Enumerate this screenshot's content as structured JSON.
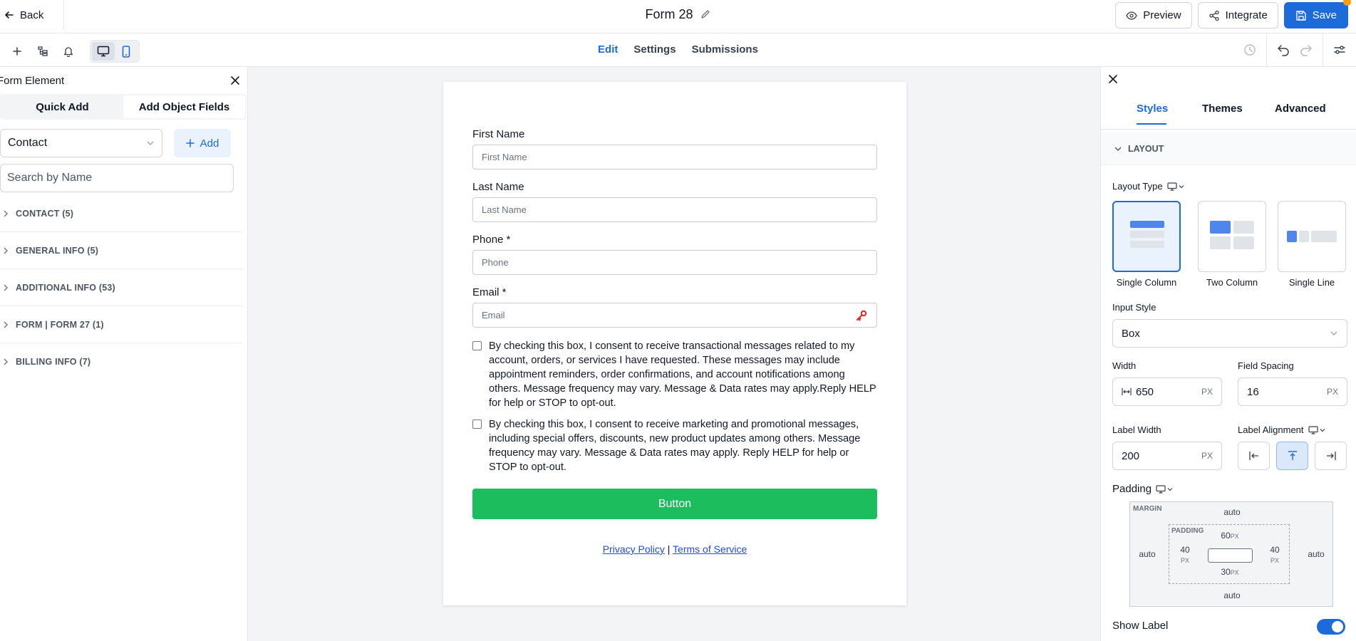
{
  "topbar": {
    "back_label": "Back",
    "form_title": "Form 28",
    "preview_label": "Preview",
    "integrate_label": "Integrate",
    "save_label": "Save"
  },
  "subbar": {
    "tabs": [
      {
        "label": "Edit",
        "active": true
      },
      {
        "label": "Settings",
        "active": false
      },
      {
        "label": "Submissions",
        "active": false
      }
    ],
    "device_selected": "desktop"
  },
  "left_panel": {
    "title": "Form Element",
    "tabs": [
      {
        "label": "Quick Add",
        "active": false
      },
      {
        "label": "Add Object Fields",
        "active": true
      }
    ],
    "object_select": "Contact",
    "add_label": "Add",
    "search_placeholder": "Search by Name",
    "categories": [
      {
        "label": "CONTACT (5)"
      },
      {
        "label": "GENERAL INFO (5)"
      },
      {
        "label": "ADDITIONAL INFO (53)"
      },
      {
        "label": "FORM | FORM 27 (1)"
      },
      {
        "label": "BILLING INFO (7)"
      }
    ]
  },
  "form": {
    "fields": [
      {
        "label": "First Name",
        "placeholder": "First Name"
      },
      {
        "label": "Last Name",
        "placeholder": "Last Name"
      },
      {
        "label": "Phone *",
        "placeholder": "Phone"
      },
      {
        "label": "Email *",
        "placeholder": "Email"
      }
    ],
    "consent_transactional": "By checking this box, I consent to receive transactional messages related to my account, orders, or services I have requested. These messages may include appointment reminders, order confirmations, and account notifications among others. Message frequency may vary. Message & Data rates may apply.Reply HELP for help or STOP to opt-out.",
    "consent_marketing": "By checking this box, I consent to receive marketing and promotional messages, including special offers, discounts, new product updates among others. Message frequency may vary. Message & Data rates may apply. Reply HELP for help or STOP to opt-out.",
    "button_label": "Button",
    "privacy_label": "Privacy Policy",
    "separator": "|",
    "terms_label": "Terms of Service"
  },
  "right_panel": {
    "tabs": [
      {
        "label": "Styles",
        "active": true
      },
      {
        "label": "Themes",
        "active": false
      },
      {
        "label": "Advanced",
        "active": false
      }
    ],
    "section_title": "LAYOUT",
    "layout_type_label": "Layout Type",
    "layout_options": [
      {
        "label": "Single Column",
        "selected": true
      },
      {
        "label": "Two Column",
        "selected": false
      },
      {
        "label": "Single Line",
        "selected": false
      }
    ],
    "input_style_label": "Input Style",
    "input_style_value": "Box",
    "width_label": "Width",
    "width_value": "650",
    "field_spacing_label": "Field Spacing",
    "field_spacing_value": "16",
    "unit": "PX",
    "label_width_label": "Label Width",
    "label_width_value": "200",
    "label_alignment_label": "Label Alignment",
    "label_alignment_selected": "top",
    "padding_label": "Padding",
    "box_model": {
      "margin_title": "MARGIN",
      "padding_title": "PADDING",
      "margin_top": "auto",
      "margin_right": "auto",
      "margin_bottom": "auto",
      "margin_left": "auto",
      "padding_top": "60",
      "padding_right": "40",
      "padding_bottom": "30",
      "padding_left": "40",
      "unit": "PX"
    },
    "show_label_label": "Show Label",
    "show_label_enabled": true
  },
  "colors": {
    "accent": "#1d6bdb",
    "submit_green": "#1bbd5c",
    "notification_dot": "#f59e0b",
    "email_key_icon": "#dc2626"
  },
  "icons": {
    "back": "arrow-left-icon",
    "edit_title": "pencil-icon",
    "preview": "eye-icon",
    "integrate": "share-icon",
    "save": "floppy-disk-icon",
    "add_element": "plus-icon",
    "layers": "layers-icon",
    "notifications": "bell-icon",
    "desktop": "monitor-icon",
    "mobile": "smartphone-icon",
    "history": "clock-history-icon",
    "undo": "undo-icon",
    "redo": "redo-icon",
    "settings": "sliders-icon",
    "close": "close-icon",
    "email_field": "key-icon"
  }
}
